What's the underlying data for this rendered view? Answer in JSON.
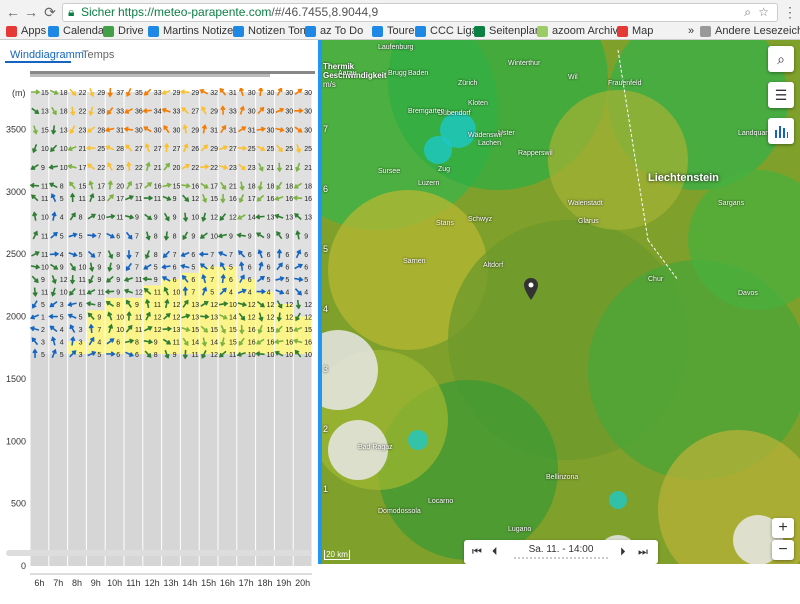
{
  "browser": {
    "secure_label": "Sicher",
    "url_scheme_host": "https://meteo-parapente.com",
    "url_rest": "/#/46.7455,8.9044,9",
    "bookmarks": [
      "Apps",
      "Calendar",
      "Drive",
      "Martins Notizen",
      "Notizen Toni",
      "az To Do",
      "Touren",
      "CCC Liga",
      "Seitenplan",
      "azoom Archiv",
      "Map",
      "Andere Lesezeichen"
    ],
    "overflow": "»"
  },
  "tabs": [
    "Winddiagramm",
    "Temps"
  ],
  "chart_data": {
    "type": "heatmap",
    "ylabel": "(m)",
    "y_ticks": [
      0,
      500,
      1000,
      1500,
      2000,
      2500,
      3000,
      3500
    ],
    "y_range": [
      0,
      3800
    ],
    "x_categories": [
      "6h",
      "7h",
      "8h",
      "9h",
      "10h",
      "11h",
      "12h",
      "13h",
      "14h",
      "15h",
      "16h",
      "17h",
      "18h",
      "19h",
      "20h"
    ],
    "levels_m": [
      3800,
      3650,
      3500,
      3350,
      3200,
      3050,
      2950,
      2800,
      2650,
      2500,
      2400,
      2300,
      2200,
      2100,
      2000,
      1900,
      1800,
      1700
    ],
    "wind_kmh": [
      [
        15,
        18,
        22,
        29,
        37,
        35,
        33,
        29,
        29,
        32,
        31,
        30,
        30,
        30,
        30
      ],
      [
        13,
        18,
        22,
        28,
        33,
        36,
        34,
        33,
        27,
        29,
        33,
        30,
        30,
        30,
        30
      ],
      [
        15,
        13,
        23,
        28,
        31,
        30,
        30,
        30,
        29,
        31,
        31,
        31,
        30,
        30,
        30
      ],
      [
        10,
        10,
        21,
        25,
        28,
        27,
        27,
        27,
        26,
        29,
        27,
        25,
        25,
        25,
        25
      ],
      [
        9,
        10,
        17,
        22,
        25,
        22,
        21,
        20,
        22,
        22,
        23,
        23,
        21,
        21,
        21
      ],
      [
        11,
        8,
        15,
        17,
        20,
        17,
        16,
        15,
        16,
        17,
        21,
        18,
        18,
        18,
        18
      ],
      [
        11,
        5,
        11,
        13,
        17,
        11,
        11,
        9,
        12,
        15,
        16,
        17,
        16,
        16,
        16
      ],
      [
        10,
        4,
        8,
        10,
        11,
        9,
        9,
        9,
        10,
        12,
        12,
        14,
        13,
        13,
        13
      ],
      [
        11,
        5,
        5,
        7,
        6,
        7,
        8,
        8,
        9,
        10,
        9,
        9,
        9,
        9,
        9
      ],
      [
        11,
        4,
        5,
        7,
        8,
        7,
        8,
        7,
        6,
        7,
        7,
        6,
        6,
        6,
        6
      ],
      [
        10,
        9,
        10,
        9,
        9,
        7,
        5,
        6,
        5,
        4,
        5,
        6,
        6,
        6,
        6
      ],
      [
        9,
        12,
        11,
        9,
        9,
        11,
        9,
        6,
        6,
        7,
        6,
        6,
        5,
        5,
        5
      ],
      [
        11,
        10,
        11,
        11,
        9,
        12,
        11,
        10,
        7,
        5,
        4,
        4,
        4,
        4,
        4
      ],
      [
        5,
        3,
        6,
        8,
        8,
        9,
        11,
        12,
        13,
        12,
        10,
        12,
        12,
        12,
        12
      ],
      [
        1,
        5,
        5,
        9,
        10,
        11,
        12,
        12,
        13,
        13,
        14,
        12,
        12,
        12,
        12
      ],
      [
        2,
        4,
        3,
        7,
        10,
        11,
        12,
        13,
        15,
        15,
        15,
        16,
        15,
        15,
        15
      ],
      [
        3,
        4,
        3,
        4,
        6,
        8,
        9,
        11,
        14,
        14,
        15,
        16,
        16,
        16,
        16
      ],
      [
        5,
        5,
        3,
        5,
        6,
        6,
        8,
        9,
        11,
        12,
        11,
        10,
        10,
        10,
        10
      ]
    ],
    "thermal_top_m": [
      1700,
      1700,
      1800,
      2050,
      2150,
      2150,
      2250,
      2300,
      2350,
      2400,
      2400,
      2300,
      2200,
      2100,
      2000
    ]
  },
  "map": {
    "legend_title": "Thermik Geschwindigkeit",
    "legend_unit": "m/s",
    "legend_ticks": [
      "7",
      "6",
      "5",
      "4",
      "3",
      "2",
      "1"
    ],
    "region_label": "Liechtenstein",
    "scale_label": "20 km",
    "time_label": "Sa. 11. - 14:00",
    "zoom_in": "+",
    "zoom_out": "−",
    "places": [
      "Laufenburg",
      "Baden",
      "Zürich",
      "Winterthur",
      "Wil",
      "Aarau",
      "Brugg",
      "Kloten",
      "Frauenfeld",
      "Dübendorf",
      "Uster",
      "Bremgarten",
      "Wädenswil",
      "Zug",
      "Rapperswil",
      "Lachen",
      "Sursee",
      "Luzern",
      "Stans",
      "Schwyz",
      "Altdorf",
      "Sarnen",
      "Walenstadt",
      "Glarus",
      "Chur",
      "Davos",
      "Bellinzona",
      "Locarno",
      "Lugano",
      "Domodossola",
      "Bad Ragaz",
      "Landquart",
      "Sargans"
    ]
  }
}
